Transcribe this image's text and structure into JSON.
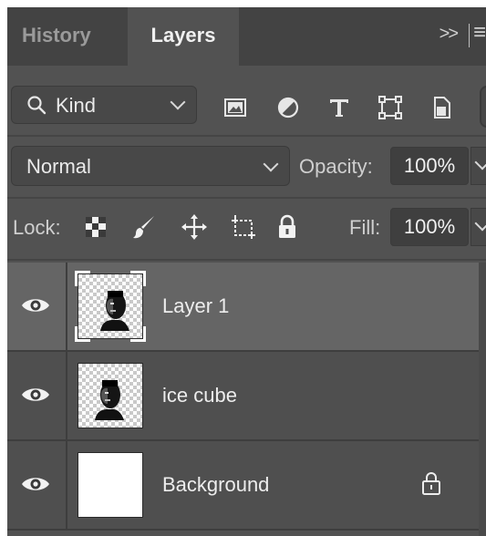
{
  "tabs": [
    {
      "label": "History",
      "active": false
    },
    {
      "label": "Layers",
      "active": true
    }
  ],
  "tab_bar": {
    "overflow_label": ">>",
    "menu_icon": "hamburger-menu-icon"
  },
  "filter": {
    "kind_label": "Kind",
    "icons": [
      "image-filter-icon",
      "adjustment-filter-icon",
      "type-filter-icon",
      "shape-filter-icon",
      "smart-object-filter-icon"
    ]
  },
  "blend": {
    "mode": "Normal",
    "opacity_label": "Opacity:",
    "opacity_value": "100%"
  },
  "lock": {
    "label": "Lock:",
    "icons": [
      "lock-transparent-pixels-icon",
      "lock-image-pixels-icon",
      "lock-position-icon",
      "lock-artboard-icon",
      "lock-all-icon"
    ],
    "fill_label": "Fill:",
    "fill_value": "100%"
  },
  "layers": [
    {
      "name": "Layer 1",
      "visible": true,
      "selected": true,
      "thumbnail": "portrait",
      "locked": false
    },
    {
      "name": "ice cube",
      "visible": true,
      "selected": false,
      "thumbnail": "portrait",
      "locked": false
    },
    {
      "name": "Background",
      "visible": true,
      "selected": false,
      "thumbnail": "white",
      "locked": true
    }
  ],
  "colors": {
    "panel_bg": "#525252",
    "tab_bar_bg": "#434343",
    "selected_row": "#656565"
  }
}
